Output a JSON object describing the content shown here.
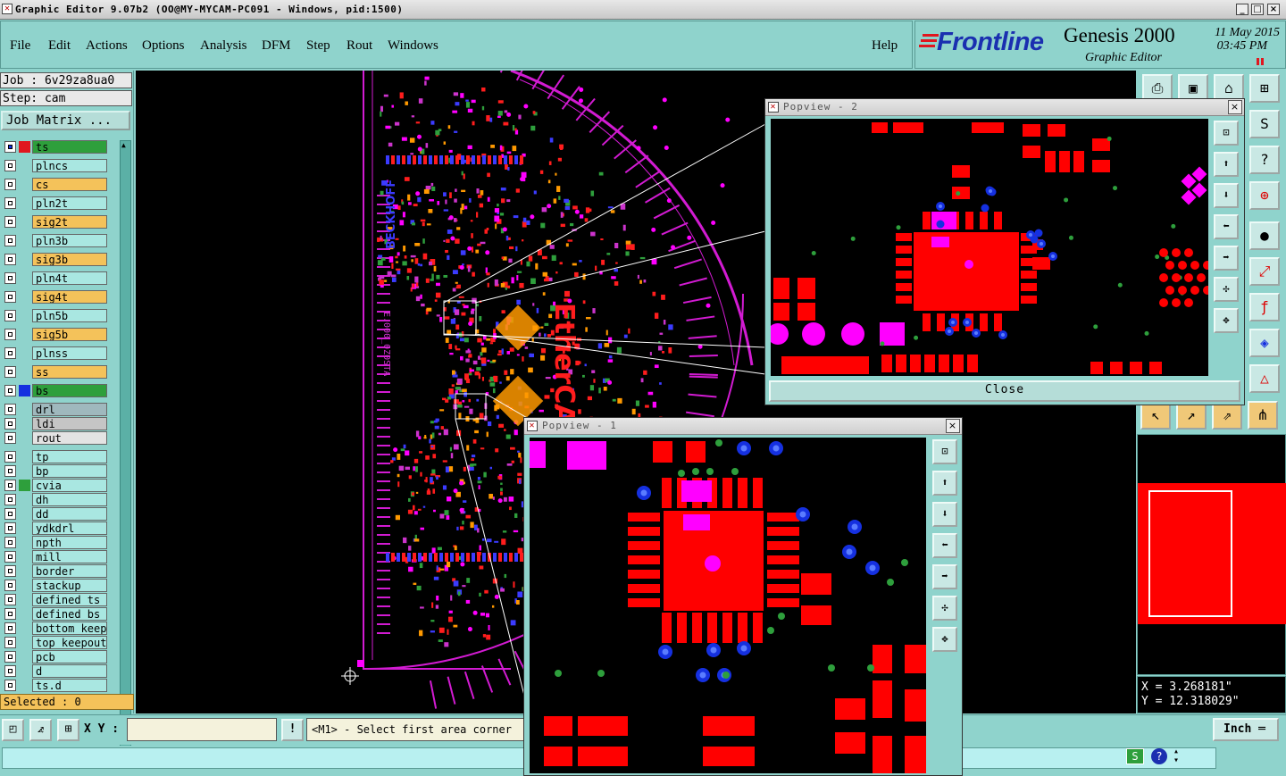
{
  "window": {
    "title": "Graphic Editor 9.07b2 (OO@MY-MYCAM-PC091 - Windows, pid:1500)",
    "min_label": "_",
    "max_label": "□",
    "close_label": "×"
  },
  "menu": {
    "items": [
      "File",
      "Edit",
      "Actions",
      "Options",
      "Analysis",
      "DFM",
      "Step",
      "Rout",
      "Windows"
    ],
    "help": "Help"
  },
  "brand": {
    "logo": "Frontline",
    "product": "Genesis 2000",
    "subtitle": "Graphic Editor",
    "date": "11 May 2015",
    "time": "03:45 PM",
    "accent_red": "#e0171f",
    "accent_blue": "#1a2fb0"
  },
  "job_panel": {
    "job_label": "Job : 6v29za8ua0",
    "step_label": "Step: cam",
    "job_matrix_button": "Job Matrix ...",
    "selected_label": "Selected : 0"
  },
  "layers": [
    {
      "name": "ts",
      "color": "#e0171f",
      "bg": "#2e9f3c",
      "fg": "#000",
      "checked": true
    },
    {
      "name": "plncs",
      "color": "",
      "bg": "#a9e7e1",
      "fg": "#000",
      "checked": false
    },
    {
      "name": "cs",
      "color": "",
      "bg": "#f4c25a",
      "fg": "#000",
      "checked": false
    },
    {
      "name": "pln2t",
      "color": "",
      "bg": "#a9e7e1",
      "fg": "#000",
      "checked": false
    },
    {
      "name": "sig2t",
      "color": "",
      "bg": "#f4c25a",
      "fg": "#000",
      "checked": false
    },
    {
      "name": "pln3b",
      "color": "",
      "bg": "#a9e7e1",
      "fg": "#000",
      "checked": false
    },
    {
      "name": "sig3b",
      "color": "",
      "bg": "#f4c25a",
      "fg": "#000",
      "checked": false
    },
    {
      "name": "pln4t",
      "color": "",
      "bg": "#a9e7e1",
      "fg": "#000",
      "checked": false
    },
    {
      "name": "sig4t",
      "color": "",
      "bg": "#f4c25a",
      "fg": "#000",
      "checked": false
    },
    {
      "name": "pln5b",
      "color": "",
      "bg": "#a9e7e1",
      "fg": "#000",
      "checked": false
    },
    {
      "name": "sig5b",
      "color": "",
      "bg": "#f4c25a",
      "fg": "#000",
      "checked": false
    },
    {
      "name": "plnss",
      "color": "",
      "bg": "#a9e7e1",
      "fg": "#000",
      "checked": false
    },
    {
      "name": "ss",
      "color": "",
      "bg": "#f4c25a",
      "fg": "#000",
      "checked": false
    },
    {
      "name": "bs",
      "color": "#1530e0",
      "bg": "#2e9f3c",
      "fg": "#000",
      "checked": false
    },
    {
      "name": "drl",
      "color": "",
      "bg": "#9fb8bd",
      "fg": "#000",
      "checked": false
    },
    {
      "name": "ldi",
      "color": "",
      "bg": "#c5c5c5",
      "fg": "#000",
      "checked": false
    },
    {
      "name": "rout",
      "color": "",
      "bg": "#e3e3e3",
      "fg": "#000",
      "checked": false
    },
    {
      "name": "tp",
      "color": "",
      "bg": "#a9e7e1",
      "fg": "#000",
      "checked": false
    },
    {
      "name": "bp",
      "color": "",
      "bg": "#a9e7e1",
      "fg": "#000",
      "checked": false
    },
    {
      "name": "cvia",
      "color": "#2e9f3c",
      "bg": "#a9e7e1",
      "fg": "#000",
      "checked": false
    },
    {
      "name": "dh",
      "color": "",
      "bg": "#a9e7e1",
      "fg": "#000",
      "checked": false
    },
    {
      "name": "dd",
      "color": "",
      "bg": "#a9e7e1",
      "fg": "#000",
      "checked": false
    },
    {
      "name": "ydkdrl",
      "color": "",
      "bg": "#a9e7e1",
      "fg": "#000",
      "checked": false
    },
    {
      "name": "npth",
      "color": "",
      "bg": "#a9e7e1",
      "fg": "#000",
      "checked": false
    },
    {
      "name": "mill",
      "color": "",
      "bg": "#a9e7e1",
      "fg": "#000",
      "checked": false
    },
    {
      "name": "border",
      "color": "",
      "bg": "#a9e7e1",
      "fg": "#000",
      "checked": false
    },
    {
      "name": "stackup",
      "color": "",
      "bg": "#a9e7e1",
      "fg": "#000",
      "checked": false
    },
    {
      "name": "defined_ts",
      "color": "",
      "bg": "#a9e7e1",
      "fg": "#000",
      "checked": false
    },
    {
      "name": "defined_bs",
      "color": "",
      "bg": "#a9e7e1",
      "fg": "#000",
      "checked": false
    },
    {
      "name": "bottom_keepe",
      "color": "",
      "bg": "#a9e7e1",
      "fg": "#000",
      "checked": false
    },
    {
      "name": "top_keepout",
      "color": "",
      "bg": "#a9e7e1",
      "fg": "#000",
      "checked": false
    },
    {
      "name": "pcb",
      "color": "",
      "bg": "#a9e7e1",
      "fg": "#000",
      "checked": false
    },
    {
      "name": "d",
      "color": "",
      "bg": "#a9e7e1",
      "fg": "#000",
      "checked": false
    },
    {
      "name": "ts.d",
      "color": "",
      "bg": "#a9e7e1",
      "fg": "#000",
      "checked": false
    }
  ],
  "board": {
    "vendor_text": "BECKHOFF",
    "product_text": "EtherCAT",
    "part_text": "E.000_0Z0STA"
  },
  "popview2": {
    "title": "Popview - 2",
    "close_label": "Close"
  },
  "popview1": {
    "title": "Popview - 1"
  },
  "readout": {
    "x": "X = 3.268181\"",
    "y": "Y = 12.318029\""
  },
  "bottom": {
    "xy_label": "X Y :",
    "xy_value": "",
    "prompt": "<M1> - Select first area corner",
    "unit_button": "Inch",
    "info_icon": "!"
  },
  "colors": {
    "panel": "#8fd3cc",
    "pad_red": "#ff0000",
    "magenta": "#ff00ff",
    "via_blue": "#1530e0",
    "drill_green": "#2e9f3c"
  }
}
